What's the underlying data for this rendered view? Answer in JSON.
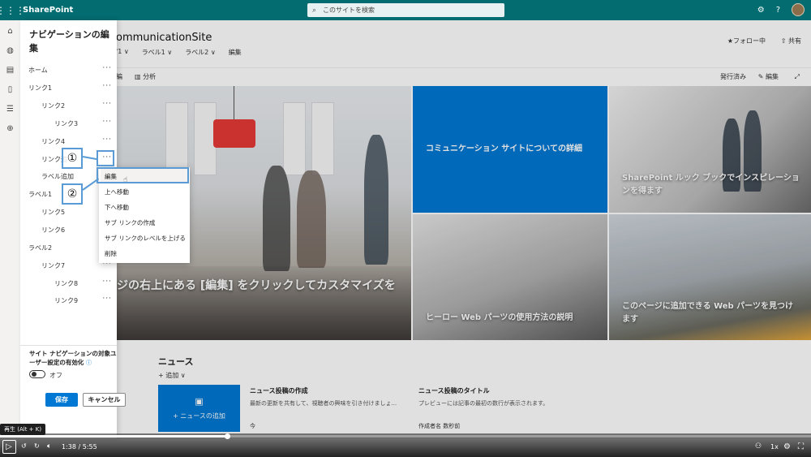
{
  "suitebar": {
    "brand": "SharePoint",
    "search_placeholder": "このサイトを検索",
    "settings_icon": "gear-icon",
    "help_label": "?",
    "color": "#036c70"
  },
  "site": {
    "title": "ommunicationSite",
    "topnav": [
      "'1 ∨",
      "ラベル1 ∨",
      "ラベル2 ∨",
      "編集"
    ],
    "follow": "★フォロー中",
    "share": "⇧ 共有"
  },
  "cmdbar": {
    "edit_left": "編",
    "analytics": "分析",
    "published": "発行済み",
    "edit": "編集"
  },
  "hero": {
    "main_text": "ジの右上にある [編集] をクリックしてカスタマイズを",
    "tile_blue": "コミュニケーション サイトについての詳細",
    "tile_a": "SharePoint ルック ブックでインスピレーションを得ます",
    "tile_b": "ヒーロー Web パーツの使用方法の説明",
    "tile_c": "このページに追加できる Web パーツを見つけます",
    "accent": "#0078d4"
  },
  "news": {
    "title": "ニュース",
    "add": "+ 追加 ∨",
    "card_label": "+ ニュースの追加",
    "item1_title": "ニュース投稿の作成",
    "item1_desc": "最新の更新を共有して、視聴者の興味を引き付けましょ...",
    "item1_meta": "今",
    "item2_title": "ニュース投稿のタイトル",
    "item2_desc": "プレビューには記事の最初の数行が表示されます。",
    "item2_meta": "作成者名  数秒前"
  },
  "nav_panel": {
    "title": "ナビゲーションの編集",
    "items": [
      {
        "label": "ホーム",
        "indent": 0
      },
      {
        "label": "リンク1",
        "indent": 0
      },
      {
        "label": "リンク2",
        "indent": 1
      },
      {
        "label": "リンク3",
        "indent": 2
      },
      {
        "label": "リンク4",
        "indent": 1
      },
      {
        "label": "リンク追",
        "indent": 1
      },
      {
        "label": "ラベル追加",
        "indent": 1
      },
      {
        "label": "ラベル1",
        "indent": 0
      },
      {
        "label": "リンク5",
        "indent": 1
      },
      {
        "label": "リンク6",
        "indent": 1
      },
      {
        "label": "ラベル2",
        "indent": 0
      },
      {
        "label": "リンク7",
        "indent": 1
      },
      {
        "label": "リンク8",
        "indent": 2
      },
      {
        "label": "リンク9",
        "indent": 2
      }
    ],
    "more": "···",
    "audience_label": "サイト ナビゲーションの対象ユーザー設定の有効化",
    "info": "ⓘ",
    "toggle_state": "オフ",
    "save": "保存",
    "cancel": "キャンセル"
  },
  "context_menu": {
    "items": [
      "編集",
      "上へ移動",
      "下へ移動",
      "サブ リンクの作成",
      "サブ リンクのレベルを上げる",
      "削除"
    ]
  },
  "annotations": {
    "one": "①",
    "two": "②",
    "color": "#5b9bd5"
  },
  "player": {
    "tooltip": "再生 (Alt + K)",
    "time": "1:38 / 5:55",
    "progress": 0.28,
    "speed": "1x"
  }
}
